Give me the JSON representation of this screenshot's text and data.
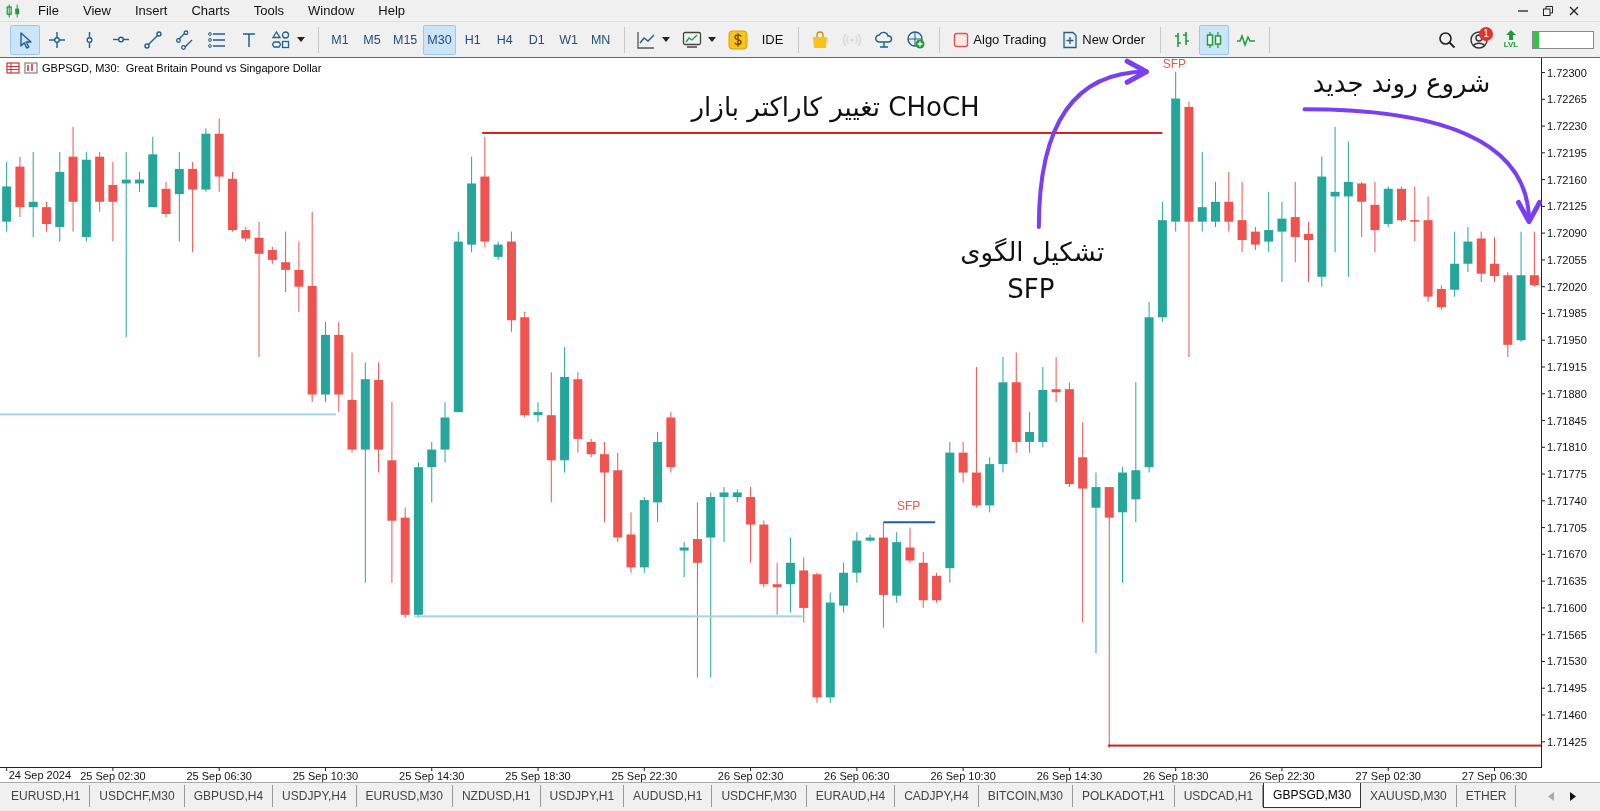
{
  "menu": {
    "items": [
      "File",
      "View",
      "Insert",
      "Charts",
      "Tools",
      "Window",
      "Help"
    ]
  },
  "toolbar": {
    "tools": [
      {
        "kind": "cursor",
        "selected": true
      },
      {
        "kind": "crosshair",
        "selected": false
      },
      {
        "kind": "vline",
        "selected": false
      },
      {
        "kind": "hline",
        "selected": false
      },
      {
        "kind": "trendline",
        "selected": false
      },
      {
        "kind": "channel",
        "selected": false
      },
      {
        "kind": "fibo",
        "selected": false
      },
      {
        "kind": "text",
        "selected": false
      },
      {
        "kind": "shapes",
        "selected": false
      }
    ],
    "timeframes": [
      {
        "label": "M1",
        "selected": false
      },
      {
        "label": "M5",
        "selected": false
      },
      {
        "label": "M15",
        "selected": false
      },
      {
        "label": "M30",
        "selected": true
      },
      {
        "label": "H1",
        "selected": false
      },
      {
        "label": "H4",
        "selected": false
      },
      {
        "label": "D1",
        "selected": false
      },
      {
        "label": "W1",
        "selected": false
      },
      {
        "label": "MN",
        "selected": false
      }
    ],
    "chart_menus": [
      {
        "kind": "line-chart"
      },
      {
        "kind": "indicators"
      }
    ],
    "buttons": [
      {
        "kind": "dollar",
        "disabled": false
      },
      {
        "kind": "text",
        "label": "IDE",
        "disabled": false
      },
      {
        "kind": "bag",
        "disabled": false
      },
      {
        "kind": "signal",
        "disabled": true
      },
      {
        "kind": "cloud",
        "disabled": false
      },
      {
        "kind": "vps",
        "disabled": false
      },
      {
        "kind": "algo",
        "label": "Algo Trading",
        "disabled": false
      },
      {
        "kind": "order",
        "label": "New Order",
        "disabled": false
      }
    ],
    "chart_types": [
      {
        "kind": "bars",
        "selected": false
      },
      {
        "kind": "candles",
        "selected": true
      },
      {
        "kind": "line",
        "selected": false
      }
    ],
    "account_badge": "1",
    "lvl_label": "LVL",
    "level": 0.1
  },
  "chart": {
    "title": "GBPSGD, M30:  Great Britain Pound vs Singapore Dollar",
    "start_date": "24 Sep 2024",
    "chart_data": {
      "type": "candlestick",
      "categories": [
        null,
        null,
        null,
        null,
        null,
        null,
        null,
        null,
        "25 Sep 02:30",
        null,
        null,
        null,
        null,
        null,
        null,
        null,
        "25 Sep 06:30",
        null,
        null,
        null,
        null,
        null,
        null,
        null,
        "25 Sep 10:30",
        null,
        null,
        null,
        null,
        null,
        null,
        null,
        "25 Sep 14:30",
        null,
        null,
        null,
        null,
        null,
        null,
        null,
        "25 Sep 18:30",
        null,
        null,
        null,
        null,
        null,
        null,
        null,
        "25 Sep 22:30",
        null,
        null,
        null,
        null,
        null,
        null,
        null,
        "26 Sep 02:30",
        null,
        null,
        null,
        null,
        null,
        null,
        null,
        "26 Sep 06:30",
        null,
        null,
        null,
        null,
        null,
        null,
        null,
        "26 Sep 10:30",
        null,
        null,
        null,
        null,
        null,
        null,
        null,
        "26 Sep 14:30",
        null,
        null,
        null,
        null,
        null,
        null,
        null,
        "26 Sep 18:30",
        null,
        null,
        null,
        null,
        null,
        null,
        null,
        "26 Sep 22:30",
        null,
        null,
        null,
        null,
        null,
        null,
        null,
        "27 Sep 02:30",
        null,
        null,
        null,
        null,
        null,
        null,
        null,
        "27 Sep 06:30",
        null,
        null,
        null
      ],
      "ylim": [
        1.71392,
        1.72319
      ],
      "yticks": [
        {
          "value": 1.723,
          "label": "1.72300"
        },
        {
          "value": 1.72265,
          "label": "1.72265"
        },
        {
          "value": 1.7223,
          "label": "1.72230"
        },
        {
          "value": 1.72195,
          "label": "1.72195"
        },
        {
          "value": 1.7216,
          "label": "1.72160"
        },
        {
          "value": 1.72125,
          "label": "1.72125"
        },
        {
          "value": 1.7209,
          "label": "1.72090"
        },
        {
          "value": 1.72055,
          "label": "1.72055"
        },
        {
          "value": 1.7202,
          "label": "1.72020"
        },
        {
          "value": 1.71985,
          "label": "1.71985"
        },
        {
          "value": 1.7195,
          "label": "1.71950"
        },
        {
          "value": 1.71915,
          "label": "1.71915"
        },
        {
          "value": 1.7188,
          "label": "1.71880"
        },
        {
          "value": 1.71845,
          "label": "1.71845"
        },
        {
          "value": 1.7181,
          "label": "1.71810"
        },
        {
          "value": 1.71775,
          "label": "1.71775"
        },
        {
          "value": 1.7174,
          "label": "1.71740"
        },
        {
          "value": 1.71705,
          "label": "1.71705"
        },
        {
          "value": 1.7167,
          "label": "1.71670"
        },
        {
          "value": 1.71635,
          "label": "1.71635"
        },
        {
          "value": 1.716,
          "label": "1.71600"
        },
        {
          "value": 1.71565,
          "label": "1.71565"
        },
        {
          "value": 1.7153,
          "label": "1.71530"
        },
        {
          "value": 1.71495,
          "label": "1.71495"
        },
        {
          "value": 1.7146,
          "label": "1.71460"
        },
        {
          "value": 1.71425,
          "label": "1.71425"
        }
      ],
      "ohlc": [
        [
          1.72105,
          1.72183,
          1.72092,
          1.72151
        ],
        [
          1.72177,
          1.7219,
          1.72111,
          1.72124
        ],
        [
          1.72124,
          1.72196,
          1.72085,
          1.72131
        ],
        [
          1.72124,
          1.72131,
          1.72092,
          1.72102
        ],
        [
          1.72098,
          1.72196,
          1.72079,
          1.7217
        ],
        [
          1.7219,
          1.72229,
          1.72092,
          1.72131
        ],
        [
          1.72085,
          1.72196,
          1.72079,
          1.72186
        ],
        [
          1.7219,
          1.72196,
          1.72118,
          1.72131
        ],
        [
          1.72153,
          1.72183,
          1.72079,
          1.72131
        ],
        [
          1.72155,
          1.72196,
          1.71954,
          1.7216
        ],
        [
          1.72155,
          1.7217,
          1.72144,
          1.7216
        ],
        [
          1.72124,
          1.72216,
          1.72124,
          1.72193
        ],
        [
          1.72148,
          1.72157,
          1.72111,
          1.72115
        ],
        [
          1.72141,
          1.72196,
          1.72079,
          1.72174
        ],
        [
          1.72174,
          1.72183,
          1.72065,
          1.72147
        ],
        [
          1.72147,
          1.72227,
          1.72144,
          1.7222
        ],
        [
          1.7222,
          1.7224,
          1.72144,
          1.72164
        ],
        [
          1.72161,
          1.7217,
          1.72092,
          1.72094
        ],
        [
          1.72094,
          1.72098,
          1.72079,
          1.72083
        ],
        [
          1.72084,
          1.72105,
          1.71928,
          1.72063
        ],
        [
          1.72068,
          1.72072,
          1.7205,
          1.72055
        ],
        [
          1.72052,
          1.72092,
          1.72013,
          1.72042
        ],
        [
          1.72042,
          1.72079,
          1.71987,
          1.7202
        ],
        [
          1.72021,
          1.72118,
          1.71869,
          1.71879
        ],
        [
          1.71879,
          1.71974,
          1.71869,
          1.71957
        ],
        [
          1.71957,
          1.71974,
          1.71856,
          1.71879
        ],
        [
          1.71872,
          1.71934,
          1.71803,
          1.71807
        ],
        [
          1.71807,
          1.71921,
          1.71633,
          1.71899
        ],
        [
          1.71898,
          1.71921,
          1.71777,
          1.71807
        ],
        [
          1.71793,
          1.71869,
          1.71633,
          1.71714
        ],
        [
          1.71718,
          1.71731,
          1.71587,
          1.71591
        ],
        [
          1.71591,
          1.7179,
          1.71587,
          1.71784
        ],
        [
          1.71784,
          1.71817,
          1.71738,
          1.71807
        ],
        [
          1.71807,
          1.71869,
          1.7179,
          1.71849
        ],
        [
          1.71856,
          1.72092,
          1.71856,
          1.72079
        ],
        [
          1.72075,
          1.7219,
          1.72065,
          1.72155
        ],
        [
          1.72164,
          1.72216,
          1.72072,
          1.72079
        ],
        [
          1.72059,
          1.72079,
          1.72055,
          1.72075
        ],
        [
          1.72079,
          1.72092,
          1.71961,
          1.71976
        ],
        [
          1.7198,
          1.71987,
          1.71849,
          1.71852
        ],
        [
          1.71852,
          1.71869,
          1.71843,
          1.71856
        ],
        [
          1.71852,
          1.71908,
          1.71738,
          1.71793
        ],
        [
          1.71793,
          1.71941,
          1.71777,
          1.71902
        ],
        [
          1.71899,
          1.71908,
          1.71803,
          1.71821
        ],
        [
          1.71817,
          1.71821,
          1.71797,
          1.71801
        ],
        [
          1.71801,
          1.71817,
          1.71712,
          1.71777
        ],
        [
          1.7178,
          1.71803,
          1.71686,
          1.71692
        ],
        [
          1.71696,
          1.71725,
          1.71646,
          1.71653
        ],
        [
          1.71653,
          1.71745,
          1.71646,
          1.71741
        ],
        [
          1.71738,
          1.7183,
          1.71712,
          1.71817
        ],
        [
          1.71849,
          1.71856,
          1.71777,
          1.71784
        ],
        [
          1.71675,
          1.71686,
          1.7164,
          1.71679
        ],
        [
          1.7169,
          1.71738,
          1.71509,
          1.71659
        ],
        [
          1.71692,
          1.71751,
          1.71509,
          1.71745
        ],
        [
          1.71745,
          1.71758,
          1.71686,
          1.71751
        ],
        [
          1.71745,
          1.71755,
          1.71738,
          1.71751
        ],
        [
          1.71745,
          1.71758,
          1.71659,
          1.71709
        ],
        [
          1.71709,
          1.71714,
          1.71627,
          1.71631
        ],
        [
          1.71631,
          1.71659,
          1.71591,
          1.71627
        ],
        [
          1.71631,
          1.71692,
          1.71594,
          1.71659
        ],
        [
          1.71649,
          1.71666,
          1.71581,
          1.716
        ],
        [
          1.71644,
          1.71646,
          1.71476,
          1.71483
        ],
        [
          1.71483,
          1.7162,
          1.71476,
          1.71607
        ],
        [
          1.71603,
          1.71659,
          1.71594,
          1.71646
        ],
        [
          1.71646,
          1.71699,
          1.71633,
          1.71688
        ],
        [
          1.71688,
          1.71696,
          1.71686,
          1.71692
        ],
        [
          1.71692,
          1.71712,
          1.71574,
          1.71617
        ],
        [
          1.71616,
          1.71699,
          1.71607,
          1.71686
        ],
        [
          1.71679,
          1.71705,
          1.71659,
          1.71662
        ],
        [
          1.71659,
          1.71673,
          1.716,
          1.7161
        ],
        [
          1.71642,
          1.71646,
          1.71607,
          1.7161
        ],
        [
          1.71652,
          1.71817,
          1.71633,
          1.71803
        ],
        [
          1.71803,
          1.71817,
          1.71764,
          1.71777
        ],
        [
          1.71777,
          1.71915,
          1.71731,
          1.71734
        ],
        [
          1.71734,
          1.71797,
          1.71725,
          1.71788
        ],
        [
          1.71788,
          1.71928,
          1.71777,
          1.71895
        ],
        [
          1.71895,
          1.71934,
          1.71803,
          1.71817
        ],
        [
          1.71817,
          1.71856,
          1.71803,
          1.7183
        ],
        [
          1.71817,
          1.71915,
          1.7181,
          1.71885
        ],
        [
          1.71886,
          1.71928,
          1.71869,
          1.71882
        ],
        [
          1.71886,
          1.71895,
          1.71758,
          1.71762
        ],
        [
          1.71797,
          1.71843,
          1.71581,
          1.71756
        ],
        [
          1.71731,
          1.71777,
          1.71541,
          1.71758
        ],
        [
          1.71758,
          1.71758,
          1.71417,
          1.71718
        ],
        [
          1.71725,
          1.71784,
          1.71633,
          1.71777
        ],
        [
          1.71742,
          1.71895,
          1.71712,
          1.7178
        ],
        [
          1.71784,
          1.72,
          1.71777,
          1.7198
        ],
        [
          1.7198,
          1.72131,
          1.71974,
          1.72107
        ],
        [
          1.72105,
          1.72301,
          1.72092,
          1.72266
        ],
        [
          1.72255,
          1.72262,
          1.71928,
          1.72105
        ],
        [
          1.72105,
          1.72196,
          1.72092,
          1.72124
        ],
        [
          1.72105,
          1.72157,
          1.72098,
          1.72131
        ],
        [
          1.72131,
          1.7217,
          1.72092,
          1.72105
        ],
        [
          1.72107,
          1.72157,
          1.72065,
          1.72081
        ],
        [
          1.72092,
          1.72098,
          1.72068,
          1.72075
        ],
        [
          1.72079,
          1.72144,
          1.72065,
          1.72094
        ],
        [
          1.72092,
          1.72131,
          1.72026,
          1.72109
        ],
        [
          1.72111,
          1.72157,
          1.72052,
          1.72085
        ],
        [
          1.72089,
          1.72105,
          1.72026,
          1.72081
        ],
        [
          1.72033,
          1.7219,
          1.7202,
          1.72164
        ],
        [
          1.72138,
          1.72229,
          1.72065,
          1.72144
        ],
        [
          1.72138,
          1.7221,
          1.72033,
          1.72157
        ],
        [
          1.72155,
          1.72157,
          1.72085,
          1.72131
        ],
        [
          1.72127,
          1.72157,
          1.72065,
          1.72094
        ],
        [
          1.72102,
          1.72151,
          1.72098,
          1.72148
        ],
        [
          1.72148,
          1.72151,
          1.72105,
          1.72107
        ],
        [
          1.72107,
          1.72151,
          1.72079,
          1.72105
        ],
        [
          1.72107,
          1.72138,
          1.72,
          1.72007
        ],
        [
          1.72017,
          1.72022,
          1.7199,
          1.71993
        ],
        [
          1.72016,
          1.72092,
          1.72007,
          1.7205
        ],
        [
          1.7205,
          1.72098,
          1.72039,
          1.72079
        ],
        [
          1.72083,
          1.72092,
          1.72026,
          1.72037
        ],
        [
          1.7205,
          1.72085,
          1.72026,
          1.72034
        ],
        [
          1.72035,
          1.72039,
          1.71928,
          1.71944
        ],
        [
          1.7195,
          1.72092,
          1.71948,
          1.72035
        ],
        [
          1.72035,
          1.72092,
          1.7202,
          1.72022
        ]
      ],
      "annotations": [
        "SFP",
        "SFP",
        "تغییر کاراکتر بازار CHoCH",
        "تشکیل الگوی",
        "SFP",
        "شروع روند جدید"
      ]
    },
    "drawings": [
      {
        "kind": "hline",
        "color": "#d41f1f"
      },
      {
        "kind": "hline",
        "color": "#a8d3e6"
      },
      {
        "kind": "hline",
        "color": "#a8d3e6"
      },
      {
        "kind": "hline",
        "color": "#1f5fa8"
      },
      {
        "kind": "hline",
        "color": "#d41f1f"
      },
      {
        "kind": "arrow",
        "color": "#7a3ff0"
      },
      {
        "kind": "arrow",
        "color": "#7a3ff0"
      }
    ]
  },
  "tabs": {
    "items": [
      {
        "label": "EURUSD,H1",
        "selected": false
      },
      {
        "label": "USDCHF,M30",
        "selected": false
      },
      {
        "label": "GBPUSD,H4",
        "selected": false
      },
      {
        "label": "USDJPY,H4",
        "selected": false
      },
      {
        "label": "EURUSD,M30",
        "selected": false
      },
      {
        "label": "NZDUSD,H1",
        "selected": false
      },
      {
        "label": "USDJPY,H1",
        "selected": false
      },
      {
        "label": "AUDUSD,H1",
        "selected": false
      },
      {
        "label": "USDCHF,M30",
        "selected": false
      },
      {
        "label": "EURAUD,H4",
        "selected": false
      },
      {
        "label": "CADJPY,H4",
        "selected": false
      },
      {
        "label": "BITCOIN,M30",
        "selected": false
      },
      {
        "label": "POLKADOT,H1",
        "selected": false
      },
      {
        "label": "USDCAD,H1",
        "selected": false
      },
      {
        "label": "GBPSGD,M30",
        "selected": true
      },
      {
        "label": "XAUUSD,M30",
        "selected": false
      },
      {
        "label": "ETHER",
        "selected": false
      }
    ]
  }
}
